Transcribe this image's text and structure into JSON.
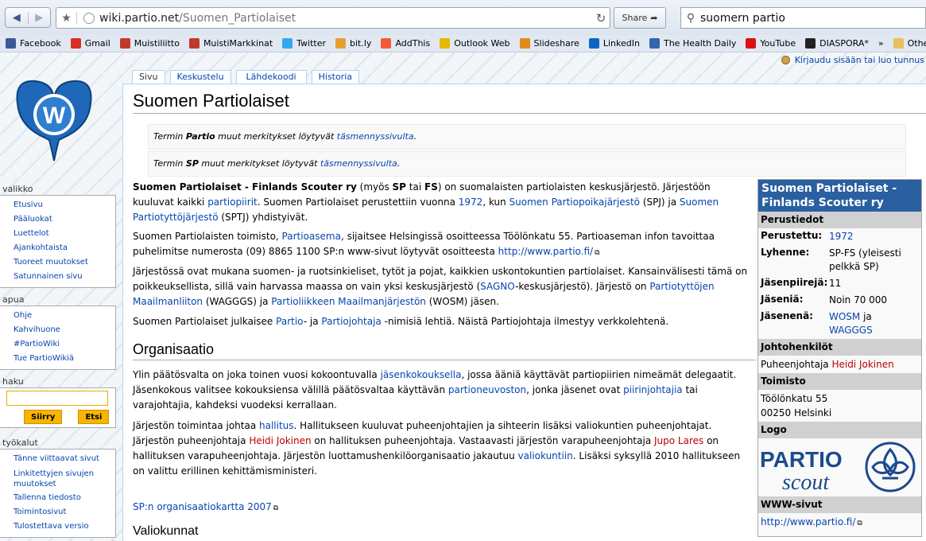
{
  "browser": {
    "url_host": "wiki.partio.net",
    "url_path": "/Suomen_Partiolaiset",
    "share_label": "Share",
    "search_text": "suomern partio"
  },
  "bookmarks": [
    {
      "label": "Facebook",
      "icon": "facebook-icon",
      "color": "#3b5998"
    },
    {
      "label": "Gmail",
      "icon": "gmail-icon",
      "color": "#d93025"
    },
    {
      "label": "Muistiliitto",
      "icon": "muistiliitto-icon",
      "color": "#c0392b"
    },
    {
      "label": "MuistiMarkkinat",
      "icon": "muistimarkkinat-icon",
      "color": "#c0392b"
    },
    {
      "label": "Twitter",
      "icon": "twitter-icon",
      "color": "#33aaee"
    },
    {
      "label": "bit.ly",
      "icon": "bitly-icon",
      "color": "#e8a033"
    },
    {
      "label": "AddThis",
      "icon": "addthis-icon",
      "color": "#f35a37"
    },
    {
      "label": "Outlook Web",
      "icon": "outlook-icon",
      "color": "#e6b800"
    },
    {
      "label": "Slideshare",
      "icon": "slideshare-icon",
      "color": "#e08a1e"
    },
    {
      "label": "LinkedIn",
      "icon": "linkedin-icon",
      "color": "#0a66c2"
    },
    {
      "label": "The Health Daily",
      "icon": "healthdaily-icon",
      "color": "#3366aa"
    },
    {
      "label": "YouTube",
      "icon": "youtube-icon",
      "color": "#d11"
    },
    {
      "label": "DIASPORA*",
      "icon": "diaspora-icon",
      "color": "#222"
    },
    {
      "label": "»",
      "icon": "chevron-icon",
      "color": ""
    },
    {
      "label": "Other bookmarks",
      "icon": "folder-icon",
      "color": "#e8c060"
    }
  ],
  "user_tools": {
    "login": "Kirjaudu sisään tai luo tunnus"
  },
  "tabs": [
    "Sivu",
    "Keskustelu",
    "Lähdekoodi",
    "Historia"
  ],
  "sidebar": {
    "valikko": {
      "title": "valikko",
      "items": [
        "Etusivu",
        "Pääluokat",
        "Luettelot",
        "Ajankohtaista",
        "Tuoreet muutokset",
        "Satunnainen sivu"
      ]
    },
    "apua": {
      "title": "apua",
      "items": [
        "Ohje",
        "Kahvihuone",
        "#PartioWiki",
        "Tue PartioWikiä"
      ]
    },
    "haku": {
      "title": "haku",
      "go": "Siirry",
      "search": "Etsi"
    },
    "tyokalut": {
      "title": "työkalut",
      "items": [
        "Tänne viittaavat sivut",
        "Linkitettyjen sivujen muutokset",
        "Tallenna tiedosto",
        "Toimintosivut",
        "Tulostettava versio"
      ]
    }
  },
  "article": {
    "title": "Suomen Partiolaiset",
    "dab1": {
      "pre": "Termin ",
      "term": "Partio",
      "mid": " muut merkitykset löytyvät ",
      "link": "täsmennyssivulta",
      "post": "."
    },
    "dab2": {
      "pre": "Termin ",
      "term": "SP",
      "mid": " muut merkitykset löytyvät ",
      "link": "täsmennyssivulta",
      "post": "."
    },
    "p1": {
      "b1": "Suomen Partiolaiset - Finlands Scouter ry",
      "t1": " (myös ",
      "b2": "SP",
      "t2": " tai ",
      "b3": "FS",
      "t3": ") on suomalaisten partiolaisten keskusjärjestö. Järjestöön kuuluvat kaikki ",
      "l1": "partiopiirit",
      "t4": ". Suomen Partiolaiset perustettiin vuonna ",
      "l2": "1972",
      "t5": ", kun ",
      "l3": "Suomen Partiopoikajärjestö",
      "t6": " (SPJ) ja ",
      "l4": "Suomen Partiotyttöjärjestö",
      "t7": " (SPTJ) yhdistyivät."
    },
    "p2": {
      "t1": "Suomen Partiolaisten toimisto, ",
      "l1": "Partioasema",
      "t2": ", sijaitsee Helsingissä osoitteessa Töölönkatu 55. Partioaseman infon tavoittaa puhelimitse numerosta (09) 8865 1100 SP:n www-sivut löytyvät osoitteesta ",
      "l2": "http://www.partio.fi/"
    },
    "p3": {
      "t1": "Järjestössä ovat mukana suomen- ja ruotsinkieliset, tytöt ja pojat, kaikkien uskontokuntien partiolaiset. Kansainvälisesti tämä on poikkeuksellista, sillä vain harvassa maassa on vain yksi keskusjärjestö (",
      "l1": "SAGNO",
      "t2": "-keskusjärjestö). Järjestö on ",
      "l2": "Partiotyttöjen Maailmanliiton",
      "t3": " (WAGGGS) ja ",
      "l3": "Partioliikkeen Maailmanjärjestön",
      "t4": " (WOSM) jäsen."
    },
    "p4": {
      "t1": "Suomen Partiolaiset julkaisee ",
      "l1": "Partio",
      "t2": "- ja ",
      "l2": "Partiojohtaja",
      "t3": " -nimisiä lehtiä. Näistä Partiojohtaja ilmestyy verkkolehtenä."
    },
    "h_org": "Organisaatio",
    "p5": {
      "t1": "Ylin päätösvalta on joka toinen vuosi kokoontuvalla ",
      "l1": "jäsenkokouksella",
      "t2": ", jossa ääniä käyttävät partiopiirien nimeämät delegaatit. Jäsenkokous valitsee kokouksiensa välillä päätösvaltaa käyttävän ",
      "l2": "partioneuvoston",
      "t3": ", jonka jäsenet ovat ",
      "l3": "piirinjohtajia",
      "t4": " tai varajohtajia, kahdeksi vuodeksi kerrallaan."
    },
    "p6": {
      "t1": "Järjestön toimintaa johtaa ",
      "l1": "hallitus",
      "t2": ". Hallitukseen kuuluvat puheenjohtajien ja sihteerin lisäksi valiokuntien puheenjohtajat. Järjestön puheenjohtaja ",
      "l2": "Heidi Jokinen",
      "t3": " on hallituksen puheenjohtaja. Vastaavasti järjestön varapuheenjohtaja ",
      "l3": "Jupo Lares",
      "t4": " on hallituksen varapuheenjohtaja. Järjestön luottamushenkilöorganisaatio jakautuu ",
      "l4": "valiokuntiin",
      "t5": ". Lisäksi syksyllä 2010 hallitukseen on valittu erillinen kehittämisministeri."
    },
    "org_chart": "SP:n organisaatiokartta 2007",
    "h_valiokunnat": "Valiokunnat"
  },
  "infobox": {
    "title": "Suomen Partiolaiset - Finlands Scouter ry",
    "sec_basic": "Perustiedot",
    "rows": [
      {
        "k": "Perustettu:",
        "v": "1972",
        "link": true
      },
      {
        "k": "Lyhenne:",
        "v": "SP-FS (yleisesti pelkkä SP)",
        "link": false
      },
      {
        "k": "Jäsenpiirejä:",
        "v": "11",
        "link": false
      },
      {
        "k": "Jäseniä:",
        "v": "Noin 70 000",
        "link": false
      }
    ],
    "member_of_k": "Jäsenenä:",
    "member_of_l1": "WOSM",
    "member_of_t": " ja",
    "member_of_l2": "WAGGGS",
    "sec_leaders": "Johtohenkilöt",
    "leader_role": "Puheenjohtaja ",
    "leader_name": "Heidi Jokinen",
    "sec_office": "Toimisto",
    "address1": "Töölönkatu 55",
    "address2": "00250 Helsinki",
    "sec_logo": "Logo",
    "logo_word1": "PARTIO",
    "logo_word2": "scout",
    "sec_www": "WWW-sivut",
    "www": "http://www.partio.fi/"
  }
}
